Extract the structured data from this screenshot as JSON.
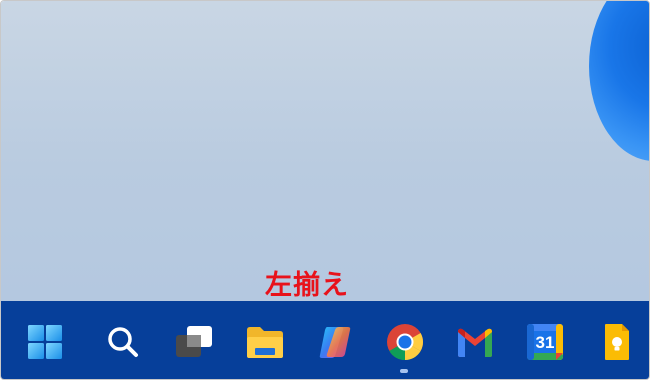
{
  "annotation": {
    "label": "左揃え",
    "color": "#e8121b"
  },
  "taskbar": {
    "alignment": "left",
    "background": "#063f9a",
    "active_app": "chrome",
    "apps": [
      {
        "id": "start",
        "icon": "windows-start-icon"
      },
      {
        "id": "search",
        "icon": "search-icon"
      },
      {
        "id": "task-view",
        "icon": "task-view-icon"
      },
      {
        "id": "file-explorer",
        "icon": "folder-icon"
      },
      {
        "id": "copilot",
        "icon": "copilot-icon"
      },
      {
        "id": "chrome",
        "icon": "chrome-icon"
      },
      {
        "id": "gmail",
        "icon": "gmail-icon"
      },
      {
        "id": "google-calendar",
        "icon": "calendar-icon",
        "text": "31"
      },
      {
        "id": "google-keep",
        "icon": "keep-icon"
      }
    ]
  }
}
